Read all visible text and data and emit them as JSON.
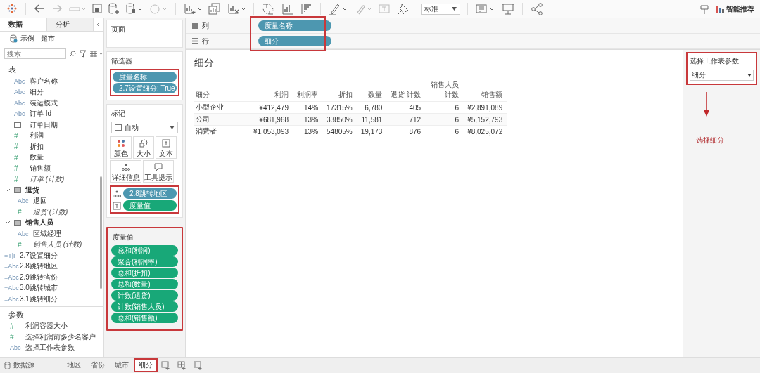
{
  "toolbar": {
    "fit_dropdown": "标准",
    "show_me": "智能推荐"
  },
  "data_pane": {
    "tabs": [
      {
        "label": "数据",
        "selected": true
      },
      {
        "label": "分析",
        "selected": false
      }
    ],
    "datasource": "示例 - 超市",
    "search": {
      "placeholder": "搜索"
    },
    "tables_heading": "表",
    "fields": [
      {
        "kind": "dimension",
        "icon": "Abc",
        "label": "客户名称",
        "italic": false
      },
      {
        "kind": "dimension",
        "icon": "Abc",
        "label": "细分",
        "italic": false
      },
      {
        "kind": "dimension",
        "icon": "Abc",
        "label": "装运模式",
        "italic": false
      },
      {
        "kind": "dimension",
        "icon": "Abc",
        "label": "订单 Id",
        "italic": false
      },
      {
        "kind": "date",
        "label": "订单日期",
        "italic": false
      },
      {
        "kind": "measure",
        "icon": "#",
        "label": "利润",
        "italic": false
      },
      {
        "kind": "measure",
        "icon": "#",
        "label": "折扣",
        "italic": false
      },
      {
        "kind": "measure",
        "icon": "#",
        "label": "数量",
        "italic": false
      },
      {
        "kind": "measure",
        "icon": "#",
        "label": "销售额",
        "italic": false
      },
      {
        "kind": "measure",
        "icon": "#",
        "label": "订单 (计数)",
        "italic": true
      },
      {
        "kind": "folder",
        "label": "退货",
        "expanded": true,
        "children": [
          {
            "kind": "dimension",
            "icon": "Abc",
            "label": "退回",
            "italic": false
          },
          {
            "kind": "measure",
            "icon": "#",
            "label": "退货 (计数)",
            "italic": true
          }
        ]
      },
      {
        "kind": "folder",
        "label": "销售人员",
        "expanded": true,
        "children": [
          {
            "kind": "dimension",
            "icon": "Abc",
            "label": "区域经理",
            "italic": false
          },
          {
            "kind": "measure",
            "icon": "#",
            "label": "销售人员 (计数)",
            "italic": true
          }
        ]
      },
      {
        "kind": "calc",
        "icon": "=T|F",
        "label": "2.7设置细分",
        "italic": false
      },
      {
        "kind": "calc",
        "icon": "=Abc",
        "label": "2.8跳转地区",
        "italic": false
      },
      {
        "kind": "calc",
        "icon": "=Abc",
        "label": "2.9跳转省份",
        "italic": false
      },
      {
        "kind": "calc",
        "icon": "=Abc",
        "label": "3.0跳转城市",
        "italic": false
      },
      {
        "kind": "calc",
        "icon": "=Abc",
        "label": "3.1跳转细分",
        "italic": false
      }
    ],
    "parameters_heading": "参数",
    "parameters": [
      {
        "kind": "measure",
        "icon": "#",
        "label": "利润容器大小"
      },
      {
        "kind": "measure",
        "icon": "#",
        "label": "选择利润前多少名客户"
      },
      {
        "kind": "dimension",
        "icon": "Abc",
        "label": "选择工作表参数"
      }
    ]
  },
  "pages_card": {
    "title": "页面"
  },
  "filters_card": {
    "title": "筛选器",
    "highlighted": true,
    "pills": [
      {
        "kind": "dimension",
        "label": "度量名称"
      },
      {
        "kind": "dimension",
        "label": "2.7设置细分: True"
      }
    ]
  },
  "marks_card": {
    "title": "标记",
    "mark_type": "自动",
    "buttons": [
      {
        "kind": "color",
        "label": "颜色"
      },
      {
        "kind": "size",
        "label": "大小"
      },
      {
        "kind": "text",
        "label": "文本"
      },
      {
        "kind": "detail",
        "label": "详细信息"
      },
      {
        "kind": "tooltip",
        "label": "工具提示"
      }
    ],
    "highlighted": true,
    "pills": [
      {
        "kind": "dimension",
        "label": "2.8跳转地区"
      },
      {
        "kind": "measure",
        "label": "度量值"
      }
    ]
  },
  "measure_values_card": {
    "title": "度量值",
    "highlighted": true,
    "pills": [
      {
        "kind": "measure",
        "label": "总和(利润)"
      },
      {
        "kind": "measure",
        "label": "聚合(利润率)"
      },
      {
        "kind": "measure",
        "label": "总和(折扣)"
      },
      {
        "kind": "measure",
        "label": "总和(数量)"
      },
      {
        "kind": "measure",
        "label": "计数(退货)"
      },
      {
        "kind": "measure",
        "label": "计数(销售人员)"
      },
      {
        "kind": "measure",
        "label": "总和(销售额)"
      }
    ]
  },
  "shelves": {
    "highlighted": true,
    "items": [
      {
        "kind": "columns",
        "label": "列",
        "pill": {
          "kind": "dimension",
          "label": "度量名称"
        }
      },
      {
        "kind": "rows",
        "label": "行",
        "pill": {
          "kind": "dimension",
          "label": "细分"
        }
      }
    ]
  },
  "view": {
    "title": "细分",
    "table": {
      "columns": [
        "细分",
        "利润",
        "利润率",
        "折扣",
        "数量",
        "退货 计数",
        "销售人员计数",
        "销售额"
      ],
      "rows": [
        [
          "小型企业",
          "¥412,479",
          "14%",
          "17315%",
          "6,780",
          "405",
          "6",
          "¥2,891,089"
        ],
        [
          "公司",
          "¥681,968",
          "13%",
          "33850%",
          "11,581",
          "712",
          "6",
          "¥5,152,793"
        ],
        [
          "消费者",
          "¥1,053,093",
          "13%",
          "54805%",
          "19,173",
          "876",
          "6",
          "¥8,025,072"
        ]
      ]
    }
  },
  "parameter_control": {
    "title": "选择工作表参数",
    "value": "细分",
    "highlighted": true,
    "annotation": "选择细分"
  },
  "sheet_tabs": {
    "datasource": "数据源",
    "tabs": [
      {
        "label": "地区",
        "selected": false,
        "highlighted": false
      },
      {
        "label": "省份",
        "selected": false,
        "highlighted": false
      },
      {
        "label": "城市",
        "selected": false,
        "highlighted": false
      },
      {
        "label": "细分",
        "selected": true,
        "highlighted": true
      }
    ]
  }
}
